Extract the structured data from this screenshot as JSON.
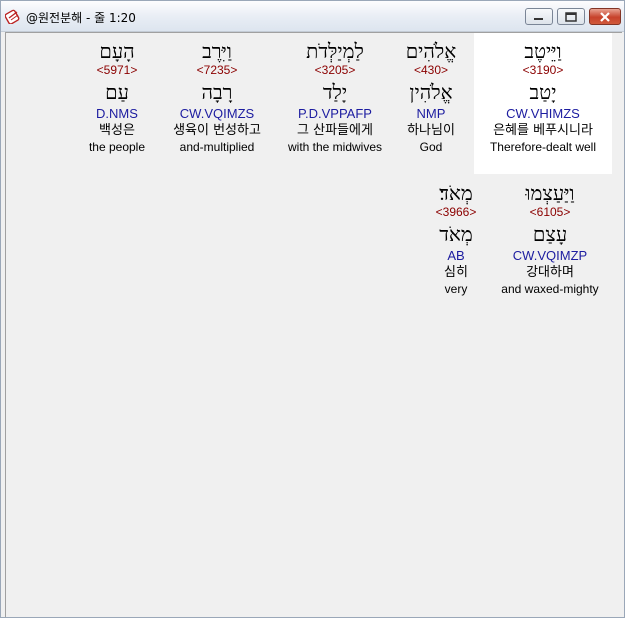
{
  "window": {
    "title": "@원전분해 - 줄 1:20",
    "minimize_label": "—",
    "maximize_label": "□",
    "close_label": "✕"
  },
  "icons": {
    "app": "app-icon",
    "minimize": "minimize-icon",
    "maximize": "maximize-icon",
    "close": "close-icon"
  },
  "colors": {
    "strong_number": "#8b0000",
    "parsing": "#1c1ca0",
    "highlight": "#ffffff"
  },
  "words": [
    {
      "hebrew": "וַיֵּיטֶב",
      "strong": "<3190>",
      "lemma": "יָטַב",
      "parsing": "CW.VHIMZS",
      "korean": "은혜를 베푸시니라",
      "english": "Therefore-dealt well",
      "highlighted": true
    },
    {
      "hebrew": "אֱלֹהִים",
      "strong": "<430>",
      "lemma": "אֱלֹהִין",
      "parsing": "NMP",
      "korean": "하나님이",
      "english": "God",
      "highlighted": false
    },
    {
      "hebrew": "לַמְיַלְּדֹת",
      "strong": "<3205>",
      "lemma": "יָלַד",
      "parsing": "P.D.VPPAFP",
      "korean": "그 산파들에게",
      "english": "with the midwives",
      "highlighted": false
    },
    {
      "hebrew": "וַיִּרֶב",
      "strong": "<7235>",
      "lemma": "רָבָה",
      "parsing": "CW.VQIMZS",
      "korean": "생육이 번성하고",
      "english": "and-multiplied",
      "highlighted": false
    },
    {
      "hebrew": "הָעָם",
      "strong": "<5971>",
      "lemma": "עַם",
      "parsing": "D.NMS",
      "korean": "백성은",
      "english": "the people",
      "highlighted": false
    },
    {
      "hebrew": "וַיַּעַצְמוּ",
      "strong": "<6105>",
      "lemma": "עָצַם",
      "parsing": "CW.VQIMZP",
      "korean": "강대하며",
      "english": "and waxed-mighty",
      "highlighted": false
    },
    {
      "hebrew": "מְאֹד׃",
      "strong": "<3966>",
      "lemma": "מְאֹד",
      "parsing": "AB",
      "korean": "심히",
      "english": "very",
      "highlighted": false
    }
  ]
}
